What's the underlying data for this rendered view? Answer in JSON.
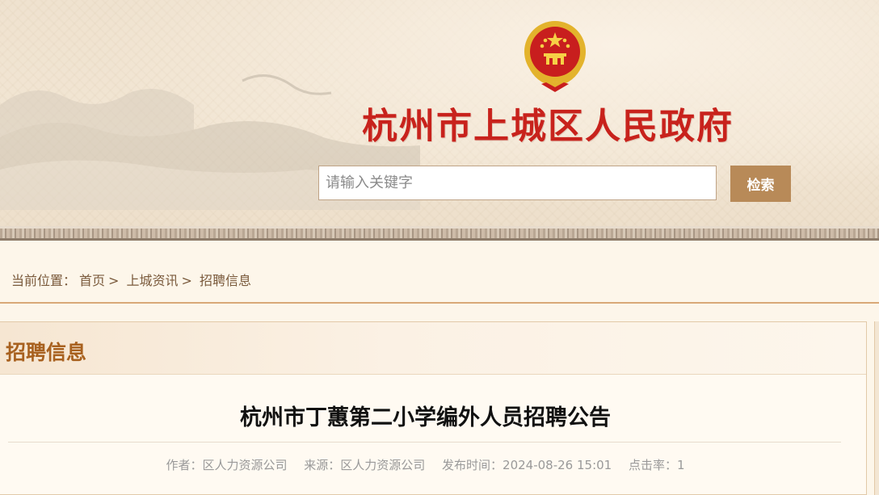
{
  "header": {
    "site_title": "杭州市上城区人民政府",
    "search_placeholder": "请输入关键字",
    "search_button": "检索",
    "title_color": "#c8221c",
    "button_color": "#b88a58"
  },
  "breadcrumb": {
    "prefix": "当前位置：",
    "items": [
      "首页",
      "上城资讯",
      "招聘信息"
    ],
    "separator": ">"
  },
  "panel": {
    "heading": "招聘信息"
  },
  "article": {
    "title": "杭州市丁蕙第二小学编外人员招聘公告",
    "author": "作者：区人力资源公司",
    "source": "来源：区人力资源公司",
    "published": "发布时间：2024-08-26 15:01",
    "clicks": "点击率：1"
  }
}
